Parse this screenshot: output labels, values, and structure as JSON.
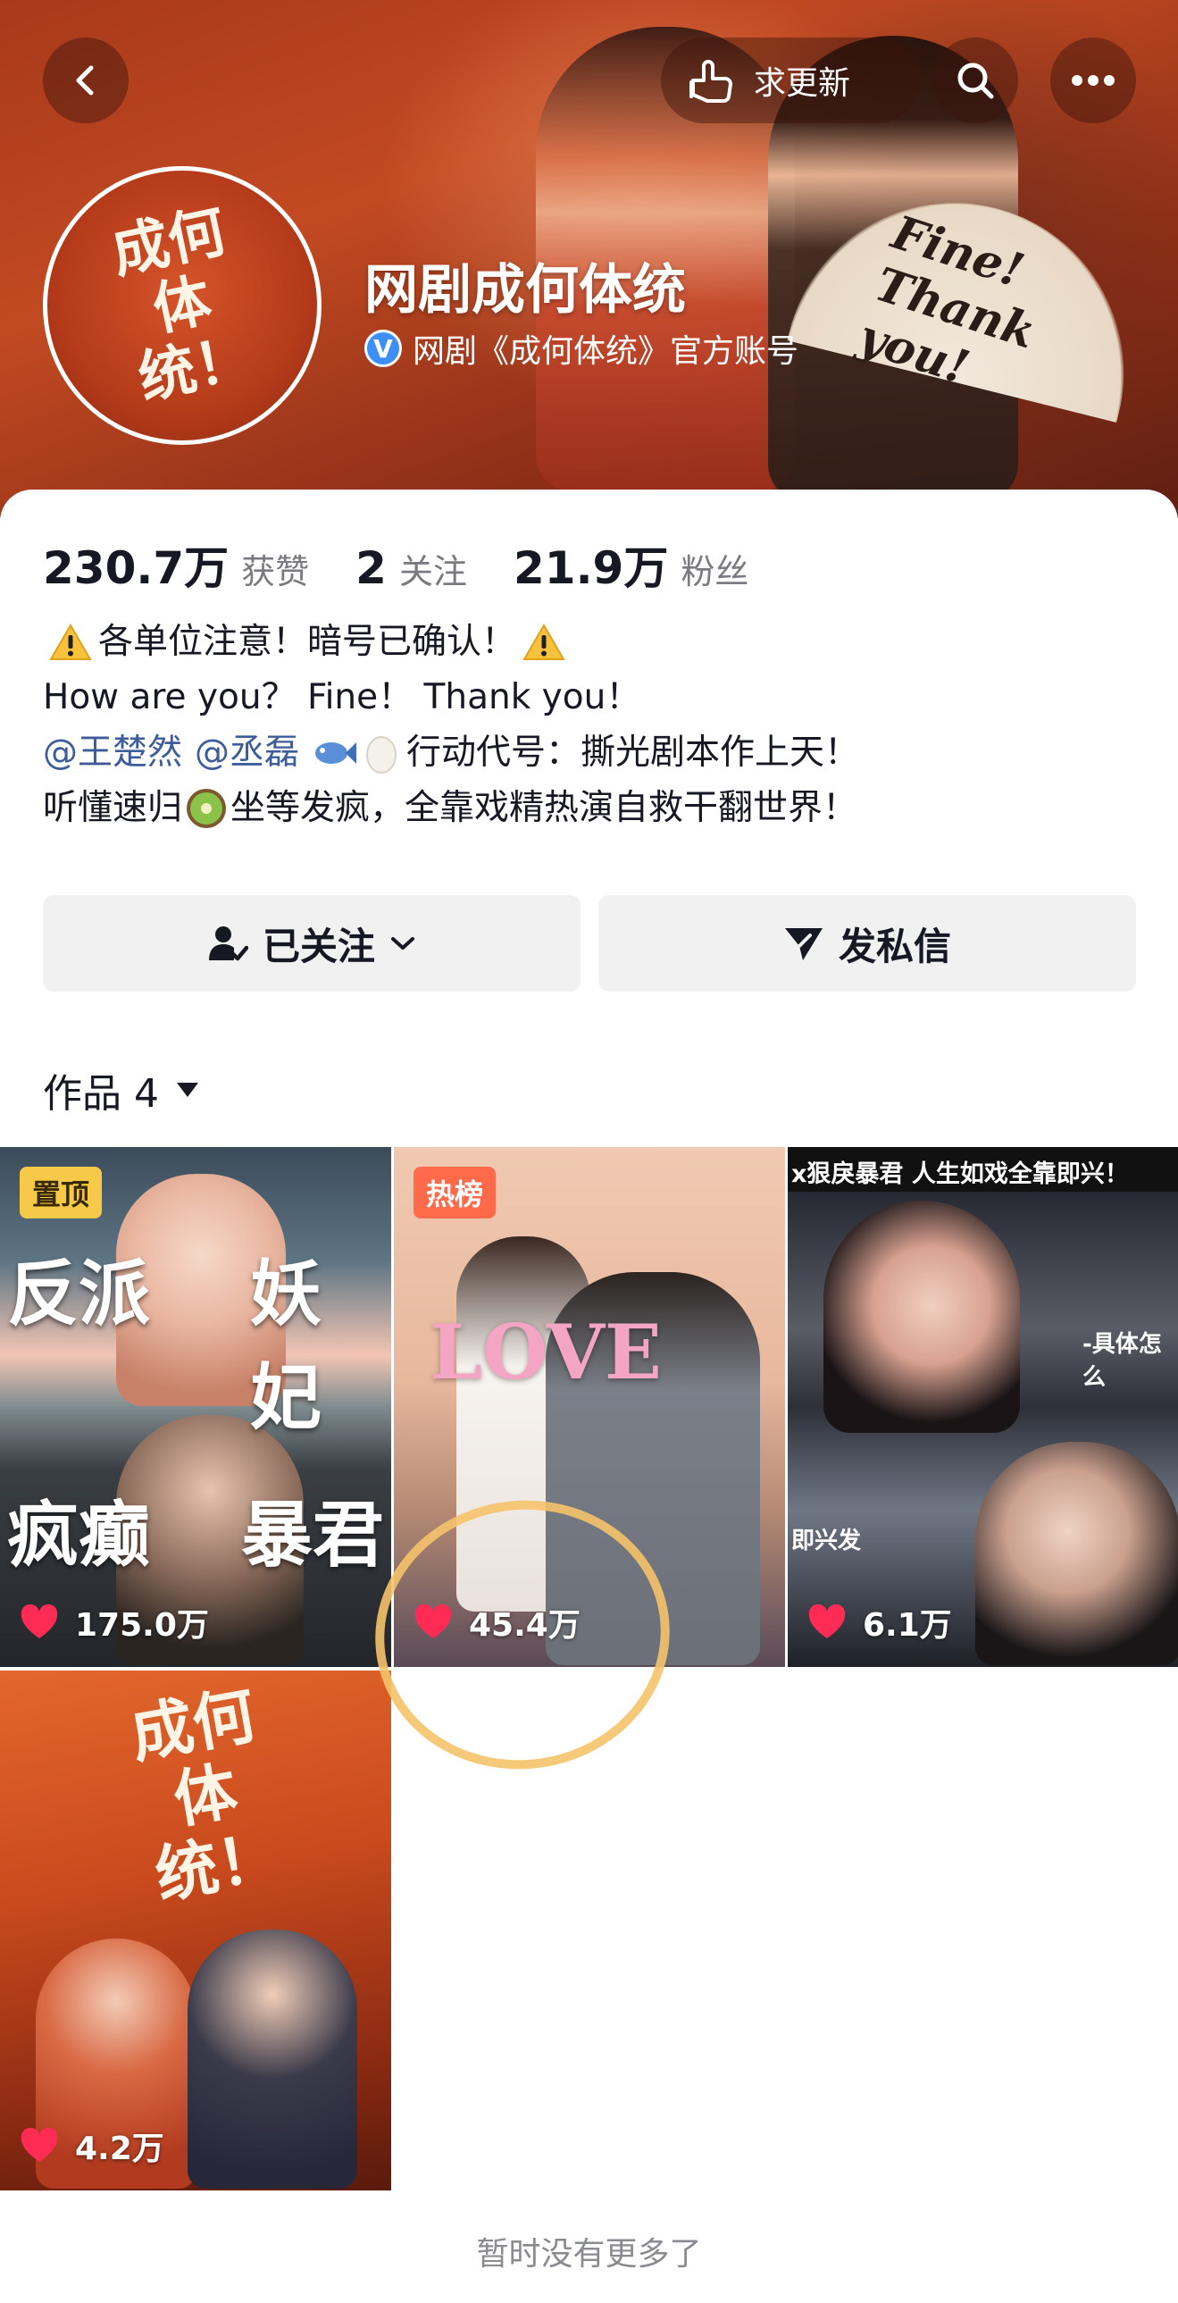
{
  "header": {
    "back_icon": "chevron-left-icon",
    "request_update_label": "求更新",
    "account_name": "网剧成何体统",
    "verification_text": "网剧《成何体统》官方账号",
    "avatar_text": "成何体统！",
    "fan_text": "Fine! Thank you!"
  },
  "stats": [
    {
      "value": "230.7万",
      "label": "获赞"
    },
    {
      "value": "2",
      "label": "关注"
    },
    {
      "value": "21.9万",
      "label": "粉丝"
    }
  ],
  "bio": {
    "line1": "各单位注意！暗号已确认！",
    "line2": "How are you？  Fine！ Thank you！",
    "mention1": "@王楚然",
    "mention2": "@丞磊",
    "line3_tail": "行动代号：撕光剧本作上天！",
    "line4_a": "听懂速归",
    "line4_b": "坐等发疯，全靠戏精热演自救干翻世界！"
  },
  "actions": {
    "follow_label": "已关注",
    "message_label": "发私信"
  },
  "works": {
    "label": "作品 4",
    "items": [
      {
        "badge": "置顶",
        "likes": "175.0万",
        "text_a": "反派",
        "text_b": "妖妃",
        "text_c": "疯癫",
        "text_d": "暴君"
      },
      {
        "badge": "热榜",
        "likes": "45.4万",
        "overlay": "LOVE"
      },
      {
        "likes": "6.1万",
        "top_caption": "x狠戾暴君  人生如戏全靠即兴！",
        "sub_caption": "-具体怎么",
        "side_caption": "即兴发"
      },
      {
        "likes": "4.2万",
        "title_text": "成何体统！"
      }
    ]
  },
  "footer": {
    "no_more": "暂时没有更多了"
  },
  "colors": {
    "accent_like": "#fe2c55",
    "pin_badge": "#f7c948",
    "hot_badge": "#fe6a4a",
    "annotation": "#f5c36a"
  }
}
